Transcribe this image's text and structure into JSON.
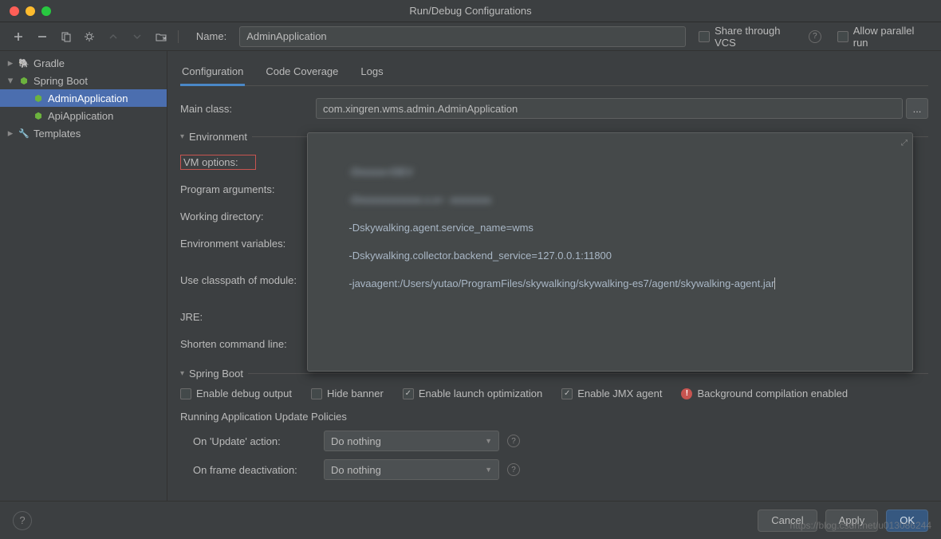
{
  "window": {
    "title": "Run/Debug Configurations"
  },
  "name_field": {
    "label": "Name:",
    "value": "AdminApplication"
  },
  "share_vcs": {
    "label": "Share through VCS",
    "checked": false
  },
  "allow_parallel": {
    "label": "Allow parallel run",
    "checked": false
  },
  "tree": {
    "gradle": "Gradle",
    "spring_boot": "Spring Boot",
    "admin_app": "AdminApplication",
    "api_app": "ApiApplication",
    "templates": "Templates"
  },
  "tabs": {
    "configuration": "Configuration",
    "code_coverage": "Code Coverage",
    "logs": "Logs"
  },
  "form": {
    "main_class_label": "Main class:",
    "main_class_value": "com.xingren.wms.admin.AdminApplication",
    "environment_section": "Environment",
    "vm_options_label": "VM options:",
    "program_arguments_label": "Program arguments:",
    "working_directory_label": "Working directory:",
    "environment_variables_label": "Environment variables:",
    "use_classpath_label": "Use classpath of module:",
    "jre_label": "JRE:",
    "shorten_cmd_label": "Shorten command line:"
  },
  "vm_options_text": {
    "line1_blur": "-Dxxxxx=DEV",
    "line2_blur": "-Dxxxxxxxxxxxx.x.x=  xxxxxxxx",
    "line3": "-Dskywalking.agent.service_name=wms",
    "line4": "-Dskywalking.collector.backend_service=127.0.0.1:11800",
    "line5": "-javaagent:/Users/yutao/ProgramFiles/skywalking/skywalking-es7/agent/skywalking-agent.jar"
  },
  "spring_boot": {
    "section": "Spring Boot",
    "enable_debug": "Enable debug output",
    "hide_banner": "Hide banner",
    "enable_launch_opt": "Enable launch optimization",
    "enable_jmx": "Enable JMX agent",
    "bg_compilation": "Background compilation enabled",
    "running_policies": "Running Application Update Policies",
    "on_update_label": "On 'Update' action:",
    "on_update_value": "Do nothing",
    "on_frame_label": "On frame deactivation:",
    "on_frame_value": "Do nothing"
  },
  "footer": {
    "cancel": "Cancel",
    "apply": "Apply",
    "ok": "OK"
  },
  "watermark": "https://blog.csdn.net/u013086244"
}
